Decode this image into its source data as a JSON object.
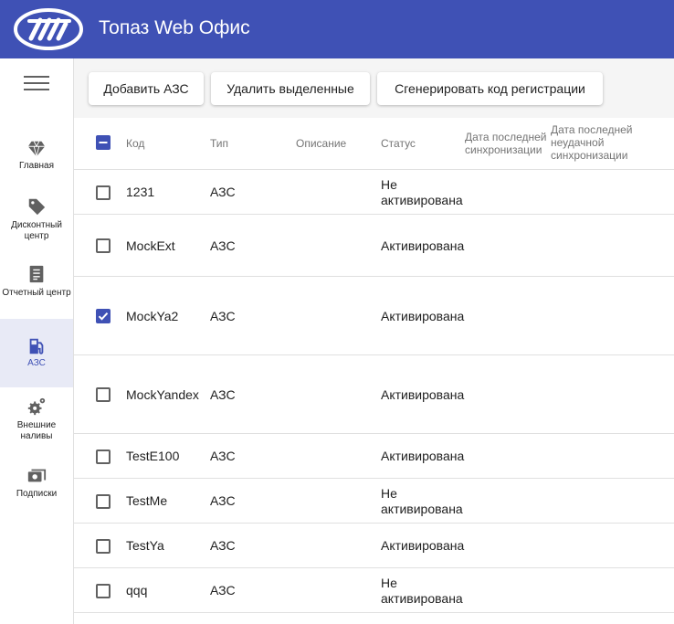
{
  "header": {
    "title": "Топаз Web Офис",
    "brand_color": "#3f51b5",
    "logo_icon": "topaz-logo"
  },
  "sidebar": {
    "menu_icon": "hamburger-icon",
    "items": [
      {
        "label": "Главная",
        "icon": "diamond-icon",
        "active": false
      },
      {
        "label": "Дисконтный центр",
        "icon": "tag-icon",
        "active": false
      },
      {
        "label": "Отчетный центр",
        "icon": "report-icon",
        "active": false
      },
      {
        "label": "АЗС",
        "icon": "gas-station-icon",
        "active": true
      },
      {
        "label": "Внешние наливы",
        "icon": "gears-icon",
        "active": false
      },
      {
        "label": "Подписки",
        "icon": "subscription-icon",
        "active": false
      }
    ]
  },
  "toolbar": {
    "add_label": "Добавить АЗС",
    "delete_label": "Удалить выделенные",
    "generate_label": "Сгенерировать код регистрации"
  },
  "table": {
    "headers": {
      "code": "Код",
      "type": "Тип",
      "description": "Описание",
      "status": "Статус",
      "last_sync": "Дата последней синхронизации",
      "last_failed_sync": "Дата последней неудачной синхронизации"
    },
    "rows": [
      {
        "code": "1231",
        "type": "АЗС",
        "description": "",
        "status": "Не активирована",
        "checked": false
      },
      {
        "code": "MockExt",
        "type": "АЗС",
        "description": "",
        "status": "Активирована",
        "checked": false
      },
      {
        "code": "MockYa2",
        "type": "АЗС",
        "description": "",
        "status": "Активирована",
        "checked": true
      },
      {
        "code": "MockYandex",
        "type": "АЗС",
        "description": "",
        "status": "Активирована",
        "checked": false
      },
      {
        "code": "TestE100",
        "type": "АЗС",
        "description": "",
        "status": "Активирована",
        "checked": false
      },
      {
        "code": "TestMe",
        "type": "АЗС",
        "description": "",
        "status": "Не активирована",
        "checked": false
      },
      {
        "code": "TestYa",
        "type": "АЗС",
        "description": "",
        "status": "Активирована",
        "checked": false
      },
      {
        "code": "qqq",
        "type": "АЗС",
        "description": "",
        "status": "Не активирована",
        "checked": false
      }
    ]
  }
}
